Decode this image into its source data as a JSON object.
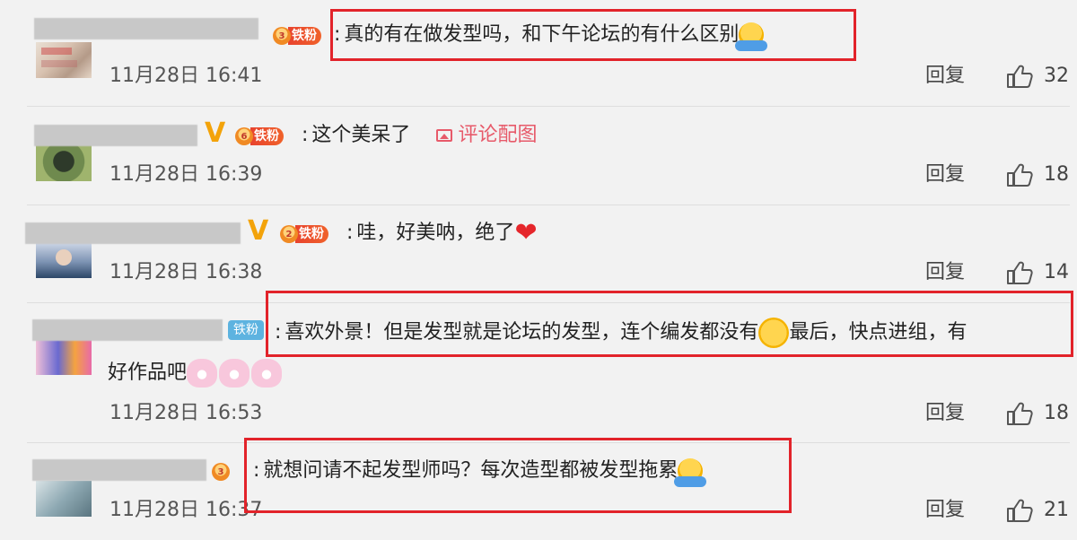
{
  "comments": [
    {
      "text": "真的有在做发型吗，和下午论坛的有什么区别",
      "fan_level": "3",
      "fan_label": "铁粉",
      "time": "11月28日 16:41",
      "reply_label": "回复",
      "likes": "32",
      "highlighted": true
    },
    {
      "text": "这个美呆了",
      "image_link": "评论配图",
      "fan_level": "6",
      "fan_label": "铁粉",
      "verified": "V",
      "time": "11月28日 16:39",
      "reply_label": "回复",
      "likes": "18",
      "highlighted": false
    },
    {
      "text": "哇，好美呐，绝了",
      "fan_level": "2",
      "fan_label": "铁粉",
      "verified": "V",
      "time": "11月28日 16:38",
      "reply_label": "回复",
      "likes": "14",
      "highlighted": false
    },
    {
      "text_part1": "喜欢外景！但是发型就是论坛的发型，连个编发都没有",
      "text_part2": "最后，快点进组，有",
      "text_line2": "好作品吧",
      "fan_label": "铁粉",
      "time": "11月28日 16:53",
      "reply_label": "回复",
      "likes": "18",
      "highlighted": true
    },
    {
      "text": "就想问请不起发型师吗？每次造型都被发型拖累",
      "fan_level": "3",
      "time": "11月28日 16:37",
      "reply_label": "回复",
      "likes": "21",
      "highlighted": true
    }
  ],
  "colors": {
    "highlight": "#e2232a",
    "fan_badge": "#e8432e",
    "verified": "#f3a30a",
    "image_link": "#e75a6a"
  }
}
